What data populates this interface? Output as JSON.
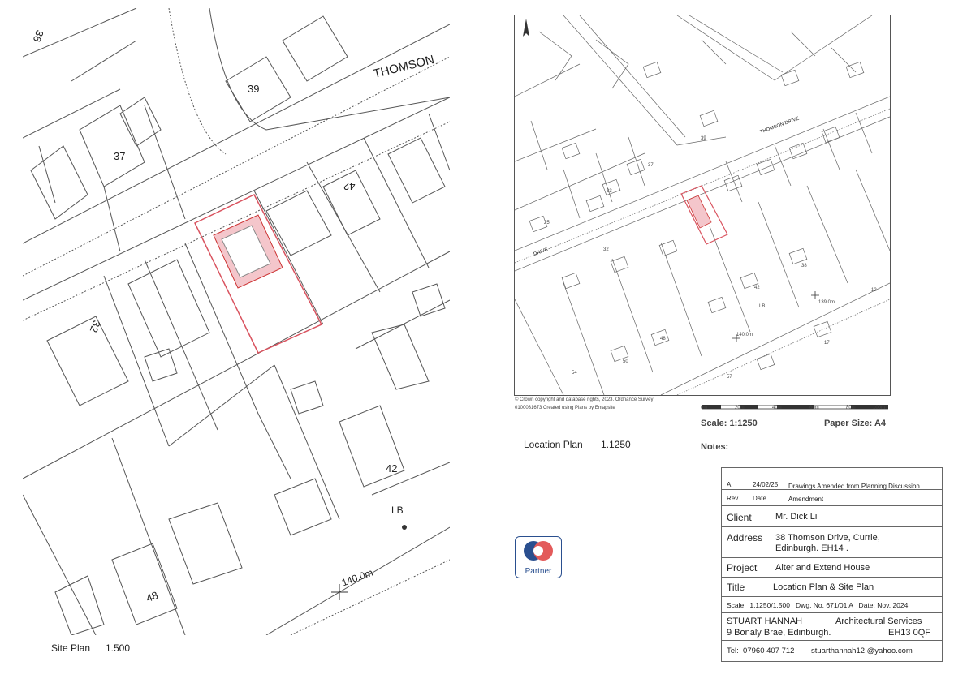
{
  "site_plan": {
    "caption": "Site Plan",
    "scale": "1.500",
    "street_label": "THOMSON",
    "house_numbers": [
      "36",
      "39",
      "37",
      "42",
      "32",
      "42",
      "48"
    ],
    "spot_height": "140.0m",
    "lb_label": "LB"
  },
  "location_plan": {
    "caption": "Location Plan",
    "scale": "1.1250",
    "street_labels": [
      "THOMSON DRIVE",
      "DRIVE"
    ],
    "spot_heights": [
      "139.0m",
      "140.0m"
    ],
    "lb_label": "LB",
    "house_numbers": [
      "39",
      "37",
      "33",
      "25",
      "32",
      "38",
      "42",
      "48",
      "50",
      "54",
      "57",
      "12",
      "17"
    ],
    "copyright_line1": "© Crown copyright and database rights, 2023. Ordnance Survey",
    "copyright_line2": "0100031673 Created using Plans by Emapsite",
    "scale_ticks": [
      "0m",
      "20m",
      "40m",
      "60m",
      "80m",
      "100m"
    ],
    "scale_label": "Scale: 1:1250",
    "paper_size": "Paper Size: A4",
    "notes_label": "Notes:"
  },
  "title_block": {
    "rev_letter": "A",
    "rev_date": "24/02/25",
    "rev_amendment": "Drawings Amended from Planning Discussion",
    "hdr_rev": "Rev.",
    "hdr_date": "Date",
    "hdr_amendment": "Amendment",
    "client_label": "Client",
    "client_value": "Mr. Dick Li",
    "address_label": "Address",
    "address_line1": "38 Thomson Drive, Currie,",
    "address_line2": "Edinburgh. EH14 .",
    "project_label": "Project",
    "project_value": "Alter and Extend House",
    "title_label": "Title",
    "title_value": "Location Plan & Site Plan",
    "scale_info": "Scale:  1.1250/1.500   Dwg. No. 671/01 A   Date: Nov. 2024",
    "firm_name": "STUART HANNAH",
    "firm_role": "Architectural Services",
    "firm_address": "9 Bonaly Brae, Edinburgh.",
    "firm_postcode": "EH13 0QF",
    "tel": "Tel:  07960 407 712",
    "email": "stuarthannah12 @yahoo.com"
  },
  "os_logo": {
    "text": "Partner"
  },
  "colors": {
    "line": "#555555",
    "highlight": "#d9535f",
    "os_blue": "#2a4f8f",
    "os_red": "#e35a5a"
  }
}
